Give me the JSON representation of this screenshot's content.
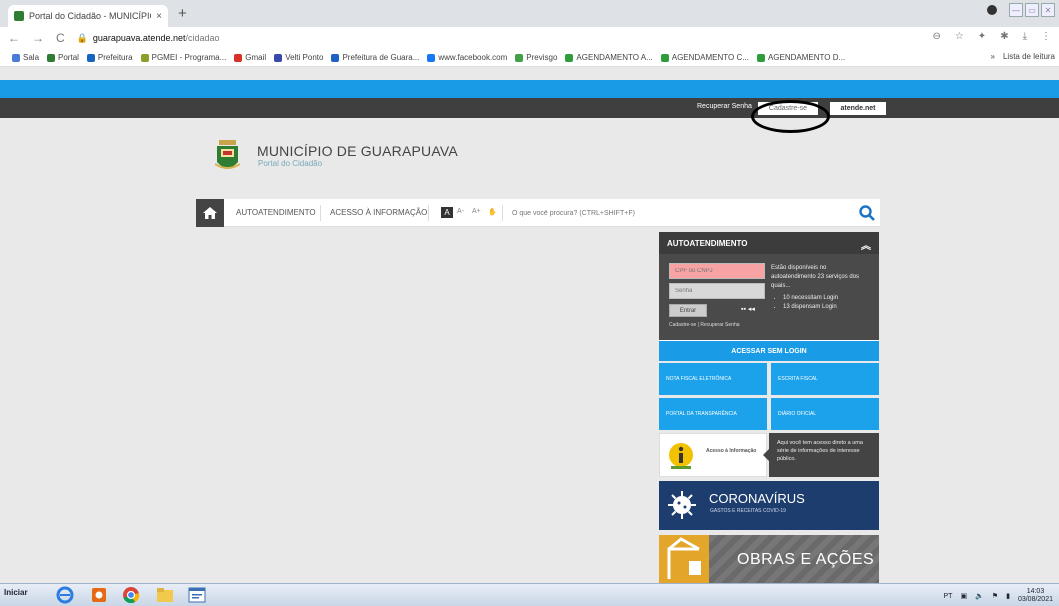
{
  "browser": {
    "tab_title": "Portal do Cidadão - MUNICÍPIO",
    "new_tab": "+",
    "close": "×",
    "url_host": "guarapuava.atende.net",
    "url_path": "/cidadao",
    "bookmarks": [
      {
        "label": "Sala",
        "color": "#4a7bd8"
      },
      {
        "label": "Portal",
        "color": "#2e7d32"
      },
      {
        "label": "Prefeitura",
        "color": "#1565c0"
      },
      {
        "label": "PGMEI - Programa...",
        "color": "#8d9e2a"
      },
      {
        "label": "Gmail",
        "color": "#d93025"
      },
      {
        "label": "Velti Ponto",
        "color": "#3949ab"
      },
      {
        "label": "Prefeitura de Guara...",
        "color": "#1e63c4"
      },
      {
        "label": "www.facebook.com",
        "color": "#1877f2"
      },
      {
        "label": "Previsgo",
        "color": "#43a047"
      },
      {
        "label": "AGENDAMENTO A...",
        "color": "#2e9e3a"
      },
      {
        "label": "AGENDAMENTO C...",
        "color": "#2e9e3a"
      },
      {
        "label": "AGENDAMENTO D...",
        "color": "#2e9e3a"
      }
    ],
    "bookmarks_more": "»",
    "reading_list": "Lista de leitura"
  },
  "site": {
    "top_links": {
      "recover_password": "Recuperar Senha",
      "register": "Cadastre-se",
      "atende": "atende.net"
    },
    "brand": {
      "title": "MUNICÍPIO DE GUARAPUAVA",
      "subtitle": "Portal do Cidadão"
    },
    "menu": {
      "self_service": "AUTOATENDIMENTO",
      "info_access": "ACESSO À INFORMAÇÃO",
      "font_a": "A",
      "font_minus": "A-",
      "font_plus": "A+",
      "search_placeholder": "O que você procura? (CTRL+SHIFT+F)"
    },
    "panel": {
      "header": "AUTOATENDIMENTO",
      "cpf_placeholder": "CPF ou CNPJ",
      "password_placeholder": "Senha",
      "enter": "Entrar",
      "register_link": "Cadastre-se",
      "link_separator": "|",
      "recover_link": "Recuperar Senha",
      "description": "Estão disponíveis no autoatendimento 23 serviços dos quais...",
      "bullets": [
        "10 necessitam Login",
        "13 dispensam Login"
      ],
      "no_login": "ACESSAR SEM LOGIN",
      "tiles": [
        "NOTA FISCAL ELETRÔNICA",
        "ESCRITA FISCAL",
        "PORTAL DA TRANSPARÊNCIA",
        "DIÁRIO OFICIAL"
      ],
      "info_label": "Acesso à Informação",
      "info_text": "Aqui você tem acesso direto a uma série de informações de interesse público.",
      "corona_title": "CORONAVÍRUS",
      "corona_sub": "GASTOS E RECEITAS COVID-19",
      "obras_title": "OBRAS E AÇÕES"
    }
  },
  "taskbar": {
    "start": "Iniciar",
    "lang": "PT",
    "time": "14:03",
    "date": "03/08/2021"
  }
}
